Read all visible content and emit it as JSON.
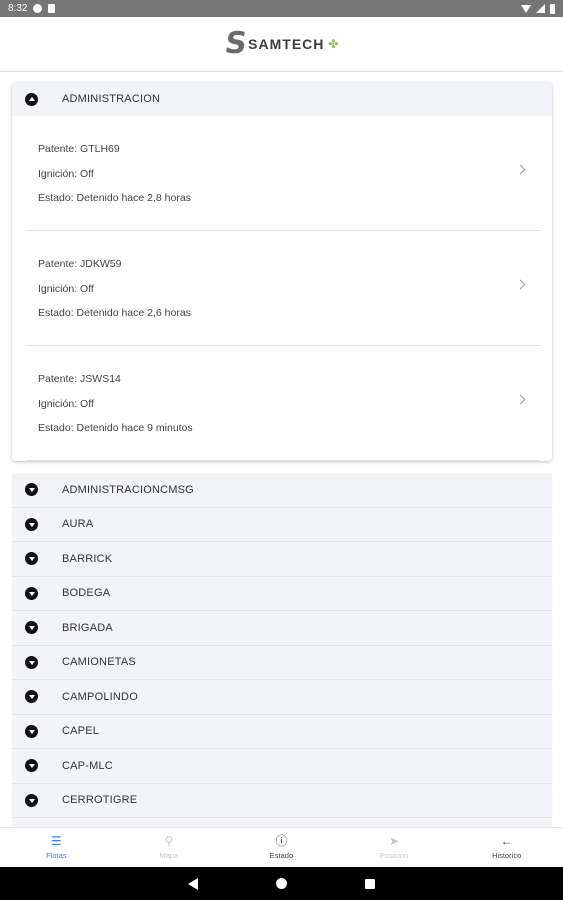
{
  "status_bar": {
    "time": "8:32",
    "icons": [
      "g-icon",
      "sd-card-icon",
      "wifi-icon",
      "signal-icon",
      "battery-icon"
    ]
  },
  "header": {
    "logo_mark": "S",
    "brand": "SAMTECH",
    "flower": "✤"
  },
  "expanded_group": {
    "name": "ADMINISTRACION",
    "vehicles": [
      {
        "patente": "Patente: GTLH69",
        "ignicion": "Ignición: Off",
        "estado": "Estado: Detenido hace 2,8 horas"
      },
      {
        "patente": "Patente: JDKW59",
        "ignicion": "Ignición: Off",
        "estado": "Estado: Detenido hace 2,6 horas"
      },
      {
        "patente": "Patente: JSWS14",
        "ignicion": "Ignición: Off",
        "estado": "Estado: Detenido hace 9 minutos"
      }
    ]
  },
  "groups": [
    "ADMINISTRACIONCMSG",
    "AURA",
    "BARRICK",
    "BODEGA",
    "BRIGADA",
    "CAMIONETAS",
    "CAMPOLINDO",
    "CAPEL",
    "CAP-MLC",
    "CERROTIGRE"
  ],
  "bottom_nav": [
    {
      "label": "Flotas",
      "icon": "list-icon",
      "glyph": "☰",
      "state": "active"
    },
    {
      "label": "Mapa",
      "icon": "map-pin-icon",
      "glyph": "⚲",
      "state": "disabled"
    },
    {
      "label": "Estado",
      "icon": "info-icon",
      "glyph": "ⓘ",
      "state": "normal"
    },
    {
      "label": "Posicion",
      "icon": "navigation-icon",
      "glyph": "➤",
      "state": "disabled"
    },
    {
      "label": "Historico",
      "icon": "arrow-left-icon",
      "glyph": "←",
      "state": "normal"
    }
  ],
  "colors": {
    "active": "#3f7ee8",
    "disabled": "#c8c8c8",
    "group_bg": "#f3f4f7",
    "status_bar": "#757575",
    "logo_accent": "#8bc34a"
  }
}
